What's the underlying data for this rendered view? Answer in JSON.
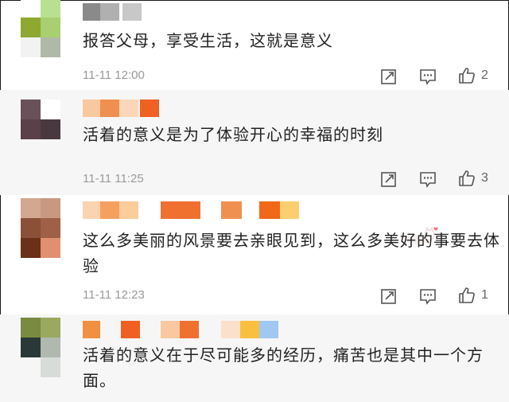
{
  "colors": {
    "text": "#222222",
    "meta": "#9a9a9a",
    "icon": "#555555",
    "name_orange": "#f08030",
    "alt_row_bg": "#f6f6f6"
  },
  "comments": [
    {
      "text": "报答父母，享受生活，这就是意义",
      "time": "11-11 12:00",
      "likes": "2",
      "avatar_colors": [
        "#ffffff",
        "#b8e090",
        "#8fa830",
        "#a8d070"
      ]
    },
    {
      "text": "活着的意义是为了体验开心的幸福的时刻",
      "time": "11-11 11:25",
      "likes": "3",
      "avatar_colors": [
        "#6a5058",
        "#ffffff",
        "#5a4048",
        "#4a3840"
      ]
    },
    {
      "text": "这么多美丽的风景要去亲眼见到，这么多美好的事要去体验",
      "time": "11-11 12:23",
      "likes": "1",
      "avatar_colors": [
        "#d4a890",
        "#c89880",
        "#8a5038",
        "#a06048"
      ]
    },
    {
      "text": "活着的意义在于尽可能多的经历，痛苦也是其中一个方面。",
      "time": "",
      "likes": "",
      "avatar_colors": [
        "#7a8a40",
        "#9aa860",
        "#2a3838",
        "#b0b8b0"
      ]
    }
  ],
  "icons": {
    "share": "share-icon",
    "comment": "comment-icon",
    "like": "thumbs-up-icon"
  }
}
